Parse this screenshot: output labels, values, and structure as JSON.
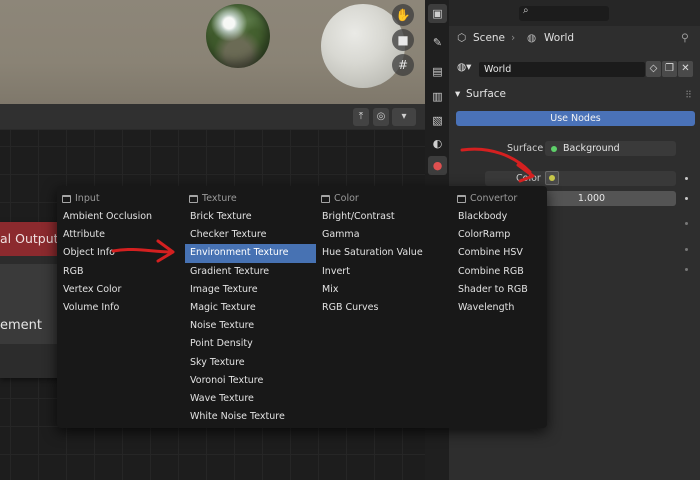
{
  "properties": {
    "breadcrumb_scene": "Scene",
    "breadcrumb_world": "World",
    "world_datablock": "World",
    "section_title": "Surface",
    "use_nodes_label": "Use Nodes",
    "surface_label": "Surface",
    "surface_value": "Background",
    "color_label": "Color",
    "strength_value": "1.000"
  },
  "node_editor": {
    "output_node_title": "al Output",
    "output_node_text": "ement"
  },
  "add_menu": {
    "columns": [
      {
        "heading": "Input",
        "items": [
          "Ambient Occlusion",
          "Attribute",
          "Object Info",
          "RGB",
          "Vertex Color",
          "Volume Info"
        ]
      },
      {
        "heading": "Texture",
        "items": [
          "Brick Texture",
          "Checker Texture",
          "Environment Texture",
          "Gradient Texture",
          "Image Texture",
          "Magic Texture",
          "Noise Texture",
          "Point Density",
          "Sky Texture",
          "Voronoi Texture",
          "Wave Texture",
          "White Noise Texture"
        ]
      },
      {
        "heading": "Color",
        "items": [
          "Bright/Contrast",
          "Gamma",
          "Hue Saturation Value",
          "Invert",
          "Mix",
          "RGB Curves"
        ]
      },
      {
        "heading": "Convertor",
        "items": [
          "Blackbody",
          "ColorRamp",
          "Combine HSV",
          "Combine RGB",
          "Shader to RGB",
          "Wavelength"
        ]
      }
    ],
    "highlighted_item": "Environment Texture"
  },
  "icons": {
    "viewport_tools": [
      "hand-icon",
      "camera-icon",
      "grid-icon"
    ],
    "sidebar_tabs": [
      "tool-icon",
      "render-icon",
      "output-icon",
      "view-layer-icon",
      "scene-icon",
      "world-icon"
    ]
  },
  "colors": {
    "accent_blue": "#4a72b8",
    "highlight_blue": "#4772b3",
    "node_output_red": "#8c2a2e",
    "annotation_red": "#d42020",
    "socket_green": "#5ed06a",
    "socket_yellow": "#c8c84a"
  }
}
